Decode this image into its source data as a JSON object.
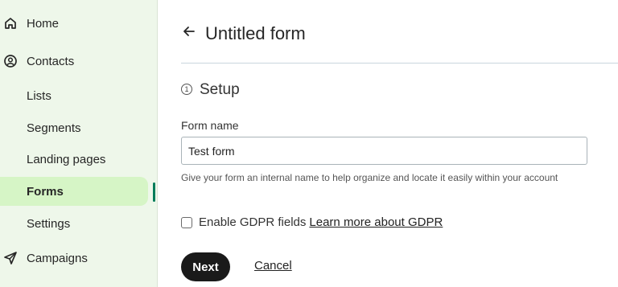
{
  "sidebar": {
    "items": [
      {
        "label": "Home",
        "icon": "home-icon"
      },
      {
        "label": "Contacts",
        "icon": "contact-icon"
      },
      {
        "label": "Lists"
      },
      {
        "label": "Segments"
      },
      {
        "label": "Landing pages"
      },
      {
        "label": "Forms",
        "active": true
      },
      {
        "label": "Settings"
      },
      {
        "label": "Campaigns",
        "icon": "send-icon"
      }
    ],
    "accent_color": "#007c5a",
    "active_bg": "#d6f5c6"
  },
  "header": {
    "back_icon": "arrow-left-icon",
    "title": "Untitled form"
  },
  "step": {
    "number": "1",
    "title": "Setup"
  },
  "form": {
    "name_label": "Form name",
    "name_value": "Test form",
    "help_text": "Give your form an internal name to help organize and locate it easily within your account",
    "gdpr_label": "Enable GDPR fields",
    "gdpr_link": "Learn more about GDPR",
    "gdpr_checked": false
  },
  "actions": {
    "next_label": "Next",
    "cancel_label": "Cancel"
  }
}
